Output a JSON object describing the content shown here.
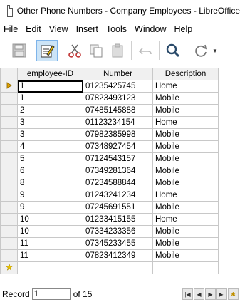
{
  "window": {
    "title": "Other Phone Numbers - Company Employees - LibreOffice"
  },
  "menu": [
    "File",
    "Edit",
    "View",
    "Insert",
    "Tools",
    "Window",
    "Help"
  ],
  "toolbar": {
    "icons": [
      "save-icon",
      "edit-data-icon",
      "cut-icon",
      "copy-icon",
      "paste-icon",
      "undo-icon",
      "find-icon",
      "refresh-icon"
    ]
  },
  "grid": {
    "columns": [
      "employee-ID",
      "Number",
      "Description"
    ],
    "rows": [
      [
        "1",
        "01235425745",
        "Home"
      ],
      [
        "1",
        "07823493123",
        "Mobile"
      ],
      [
        "2",
        "07485145888",
        "Mobile"
      ],
      [
        "3",
        "01123234154",
        "Home"
      ],
      [
        "3",
        "07982385998",
        "Mobile"
      ],
      [
        "4",
        "07348927454",
        "Mobile"
      ],
      [
        "5",
        "07124543157",
        "Mobile"
      ],
      [
        "6",
        "07349281364",
        "Mobile"
      ],
      [
        "8",
        "07234588844",
        "Mobile"
      ],
      [
        "9",
        "01243241234",
        "Home"
      ],
      [
        "9",
        "07245691551",
        "Mobile"
      ],
      [
        "10",
        "01233415155",
        "Home"
      ],
      [
        "10",
        "07334233356",
        "Mobile"
      ],
      [
        "11",
        "07345233455",
        "Mobile"
      ],
      [
        "11",
        "07823412349",
        "Mobile"
      ]
    ]
  },
  "status": {
    "record_label": "Record",
    "record_value": "1",
    "of_label": "of 15"
  },
  "colors": {
    "selection": "#cce4f7",
    "header": "#f0f0f0",
    "current_row_marker": "#e0a000",
    "new_row_marker": "#e8c000"
  }
}
